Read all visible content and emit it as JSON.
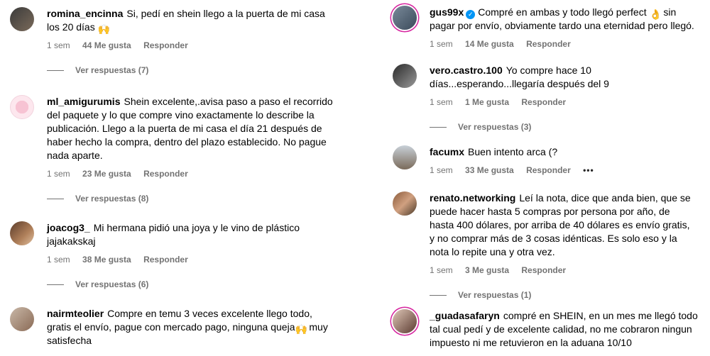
{
  "comments_left": [
    {
      "username": "romina_encinna",
      "text": "Si, pedí en shein llego a la puerta de mi casa los 20 días",
      "emoji": "🙌",
      "time": "1 sem",
      "likes": "44 Me gusta",
      "reply": "Responder",
      "view_replies": "Ver respuestas (7)"
    },
    {
      "username": "ml_amigurumis",
      "text": "Shein excelente,.avisa paso a paso el recorrido del paquete y lo que compre vino exactamente lo describe la publicación. Llego a la puerta de mi casa el día 21 después de haber hecho la compra, dentro del plazo establecido. No pague nada aparte.",
      "time": "1 sem",
      "likes": "23 Me gusta",
      "reply": "Responder",
      "view_replies": "Ver respuestas (8)"
    },
    {
      "username": "joacog3_",
      "text": "Mi hermana pidió una joya y le vino de plástico jajakakskaj",
      "time": "1 sem",
      "likes": "38 Me gusta",
      "reply": "Responder",
      "view_replies": "Ver respuestas (6)"
    },
    {
      "username": "nairmteolier",
      "text": "Compre en temu 3 veces excelente llego todo, gratis el envío, pague con mercado pago, ninguna queja",
      "emoji": "🙌",
      "text_after": "muy satisfecha"
    }
  ],
  "comments_right": [
    {
      "username": "gus99x",
      "verified": true,
      "text": "Compré en ambas y todo llegó perfect",
      "emoji": "👌",
      "text_after": "sin pagar por envío, obviamente tardo una eternidad pero llegó.",
      "time": "1 sem",
      "likes": "14 Me gusta",
      "reply": "Responder"
    },
    {
      "username": "vero.castro.100",
      "text": "Yo compre hace 10 días...esperando...llegaría después del 9",
      "time": "1 sem",
      "likes": "1 Me gusta",
      "reply": "Responder",
      "view_replies": "Ver respuestas (3)"
    },
    {
      "username": "facumx",
      "text": "Buen intento arca (?",
      "time": "1 sem",
      "likes": "33 Me gusta",
      "reply": "Responder",
      "more": "•••"
    },
    {
      "username": "renato.networking",
      "text": "Leí la nota, dice que anda bien, que se puede hacer hasta 5 compras por persona por año, de hasta 400 dólares, por arriba de 40 dólares es envío gratis, y no comprar más de 3 cosas idénticas. Es solo eso y la nota lo repite una y otra vez.",
      "time": "1 sem",
      "likes": "3 Me gusta",
      "reply": "Responder",
      "view_replies": "Ver respuestas (1)"
    },
    {
      "username": "_guadasafaryn",
      "text": "compré en SHEIN, en un mes me llegó todo tal cual pedí y de excelente calidad, no me cobraron ningun impuesto ni me retuvieron en la aduana 10/10"
    }
  ],
  "colors": {
    "muted": "#737373",
    "verified": "#0095f6",
    "story_ring": "#d6249f"
  }
}
